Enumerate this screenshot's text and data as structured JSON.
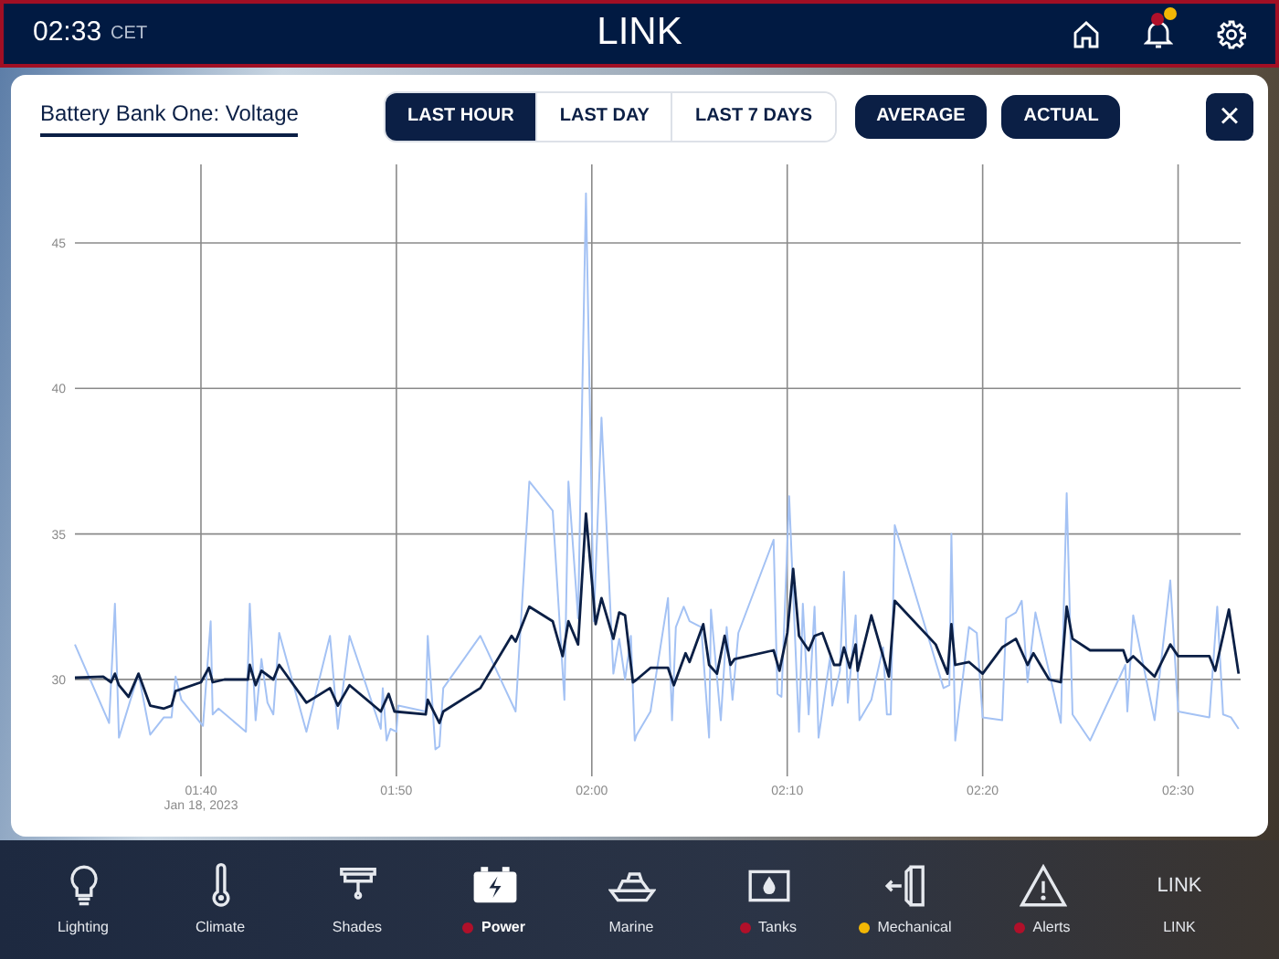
{
  "top_bar": {
    "time": "02:33",
    "timezone": "CET",
    "title": "LINK",
    "alerts": [
      {
        "color": "#b0102a"
      },
      {
        "color": "#f2b705"
      }
    ]
  },
  "panel": {
    "title": "Battery Bank One: Voltage",
    "ranges": [
      {
        "label": "LAST HOUR",
        "selected": true
      },
      {
        "label": "LAST DAY",
        "selected": false
      },
      {
        "label": "LAST 7 DAYS",
        "selected": false
      }
    ],
    "toggles": [
      {
        "label": "AVERAGE",
        "on": true
      },
      {
        "label": "ACTUAL",
        "on": true
      }
    ],
    "close": "×",
    "chart_data": {
      "type": "line",
      "grid": true,
      "xlim": [
        93.55,
        153.2
      ],
      "ylim": [
        26.67,
        47.7
      ],
      "xticks": [
        {
          "value": 100,
          "label": "01:40"
        },
        {
          "value": 110,
          "label": "01:50"
        },
        {
          "value": 120,
          "label": "02:00"
        },
        {
          "value": 130,
          "label": "02:10"
        },
        {
          "value": 140,
          "label": "02:20"
        },
        {
          "value": 150,
          "label": "02:30"
        }
      ],
      "yticks": [
        30,
        35,
        40,
        45
      ],
      "annotations": [
        "Jan 18, 2023"
      ],
      "series": [
        {
          "color": "#a4c2f4",
          "x": [
            93.55,
            95.3,
            95.6,
            95.8,
            96.8,
            97.4,
            98.1,
            98.5,
            98.7,
            99.0,
            100.1,
            100.5,
            100.6,
            100.9,
            102.3,
            102.5,
            102.8,
            103.1,
            103.4,
            103.7,
            104.0,
            105.4,
            106.6,
            107.0,
            107.6,
            109.2,
            109.3,
            109.5,
            109.7,
            110.0,
            110.1,
            111.5,
            111.6,
            112.0,
            112.2,
            112.4,
            114.3,
            116.1,
            116.8,
            118.0,
            118.6,
            118.8,
            119.3,
            119.7,
            120.1,
            120.5,
            121.1,
            121.4,
            121.7,
            122.0,
            122.2,
            122.3,
            123.0,
            123.9,
            124.1,
            124.3,
            124.7,
            125.0,
            125.6,
            126.0,
            126.1,
            126.6,
            126.9,
            127.2,
            127.5,
            129.3,
            129.5,
            129.7,
            130.1,
            130.6,
            130.8,
            131.1,
            131.4,
            131.6,
            132.2,
            132.3,
            132.7,
            132.9,
            133.1,
            133.5,
            133.7,
            134.3,
            134.9,
            135.1,
            135.3,
            135.5,
            138.0,
            138.3,
            138.4,
            138.6,
            139.3,
            139.7,
            140.0,
            141.0,
            141.2,
            141.7,
            142.0,
            142.3,
            142.7,
            144.0,
            144.3,
            144.6,
            145.5,
            147.3,
            147.4,
            147.7,
            148.8,
            149.6,
            150.0,
            151.6,
            152.0,
            152.3,
            152.7,
            153.1
          ],
          "values": [
            31.2,
            28.5,
            32.6,
            28.0,
            30.2,
            28.1,
            28.7,
            28.7,
            30.1,
            29.3,
            28.4,
            32.0,
            28.8,
            29.0,
            28.2,
            32.6,
            28.6,
            30.7,
            29.2,
            28.8,
            31.6,
            28.2,
            31.5,
            28.3,
            31.5,
            28.3,
            29.7,
            27.9,
            28.3,
            28.2,
            29.1,
            28.9,
            31.5,
            27.6,
            27.7,
            29.7,
            31.5,
            28.9,
            36.8,
            35.8,
            29.3,
            36.8,
            32.1,
            46.7,
            32.0,
            39.0,
            30.2,
            31.4,
            30.0,
            31.5,
            27.9,
            28.1,
            28.9,
            32.8,
            28.6,
            31.8,
            32.5,
            32.0,
            31.8,
            28.0,
            32.4,
            28.6,
            31.8,
            29.3,
            31.6,
            34.8,
            29.5,
            29.4,
            36.3,
            28.2,
            32.6,
            28.8,
            32.5,
            28.0,
            30.8,
            29.1,
            30.3,
            33.7,
            29.2,
            32.2,
            28.6,
            29.3,
            31.1,
            28.8,
            28.8,
            35.3,
            29.7,
            29.8,
            35.0,
            27.9,
            31.8,
            31.6,
            28.7,
            28.6,
            32.1,
            32.3,
            32.7,
            29.9,
            32.3,
            28.5,
            36.4,
            28.8,
            27.9,
            30.5,
            28.9,
            32.2,
            28.6,
            33.4,
            28.9,
            28.7,
            32.5,
            28.8,
            28.7,
            28.3
          ]
        },
        {
          "color": "#0b1f45",
          "x": [
            93.55,
            95.0,
            95.4,
            95.6,
            95.8,
            96.3,
            96.8,
            97.4,
            98.1,
            98.5,
            98.7,
            100.0,
            100.4,
            100.6,
            101.2,
            102.4,
            102.5,
            102.8,
            103.1,
            103.7,
            104.0,
            105.4,
            106.6,
            107.0,
            107.6,
            109.2,
            109.6,
            109.9,
            111.5,
            111.6,
            112.2,
            112.4,
            114.3,
            115.9,
            116.1,
            116.8,
            118.0,
            118.5,
            118.8,
            119.3,
            119.7,
            120.2,
            120.5,
            121.1,
            121.4,
            121.7,
            122.1,
            122.3,
            123.0,
            123.9,
            124.2,
            124.8,
            125.0,
            125.7,
            126.0,
            126.4,
            126.8,
            127.1,
            127.3,
            129.3,
            129.6,
            130.0,
            130.3,
            130.6,
            131.1,
            131.4,
            131.8,
            132.4,
            132.7,
            132.9,
            133.2,
            133.5,
            133.6,
            134.3,
            135.2,
            135.5,
            137.6,
            138.2,
            138.4,
            138.6,
            139.3,
            140.0,
            141.0,
            141.7,
            142.3,
            142.6,
            143.4,
            144.0,
            144.3,
            144.6,
            145.5,
            147.2,
            147.4,
            147.7,
            148.8,
            149.6,
            150.0,
            151.6,
            151.9,
            152.6,
            153.1
          ],
          "values": [
            30.06,
            30.1,
            29.9,
            30.2,
            29.8,
            29.4,
            30.2,
            29.1,
            29.0,
            29.1,
            29.6,
            29.9,
            30.4,
            29.9,
            30.0,
            30.0,
            30.5,
            29.8,
            30.3,
            30.0,
            30.5,
            29.2,
            29.7,
            29.1,
            29.8,
            28.9,
            29.5,
            28.9,
            28.8,
            29.3,
            28.5,
            28.9,
            29.7,
            31.5,
            31.3,
            32.5,
            32.0,
            30.8,
            32.0,
            31.2,
            35.7,
            31.9,
            32.8,
            31.4,
            32.3,
            32.2,
            29.9,
            30.0,
            30.4,
            30.4,
            29.8,
            30.9,
            30.6,
            31.9,
            30.5,
            30.2,
            31.5,
            30.5,
            30.7,
            31.0,
            30.3,
            31.6,
            33.8,
            31.5,
            31.0,
            31.5,
            31.6,
            30.5,
            30.5,
            31.1,
            30.4,
            31.2,
            30.3,
            32.2,
            30.1,
            32.7,
            31.2,
            30.2,
            31.9,
            30.5,
            30.6,
            30.2,
            31.1,
            31.4,
            30.5,
            30.9,
            30.0,
            29.9,
            32.5,
            31.4,
            31.0,
            31.0,
            30.6,
            30.8,
            30.1,
            31.2,
            30.8,
            30.8,
            30.3,
            32.4,
            30.2
          ]
        }
      ]
    }
  },
  "nav": [
    {
      "label": "Lighting",
      "kind": "icon",
      "selected": false
    },
    {
      "label": "Climate",
      "kind": "icon",
      "selected": false
    },
    {
      "label": "Shades",
      "kind": "icon",
      "selected": false
    },
    {
      "label": "Power",
      "kind": "icon",
      "selected": true,
      "color": "#b0102a"
    },
    {
      "label": "Marine",
      "kind": "icon",
      "selected": false
    },
    {
      "label": "Tanks",
      "kind": "icon",
      "selected": false,
      "color": "#b0102a"
    },
    {
      "label": "Mechanical",
      "kind": "icon",
      "selected": false,
      "color": "#f2b705"
    },
    {
      "label": "Alerts",
      "kind": "icon",
      "selected": false,
      "color": "#b0102a"
    },
    {
      "label": "LINK",
      "kind": "text",
      "icon_text": "LINK",
      "selected": false
    }
  ]
}
